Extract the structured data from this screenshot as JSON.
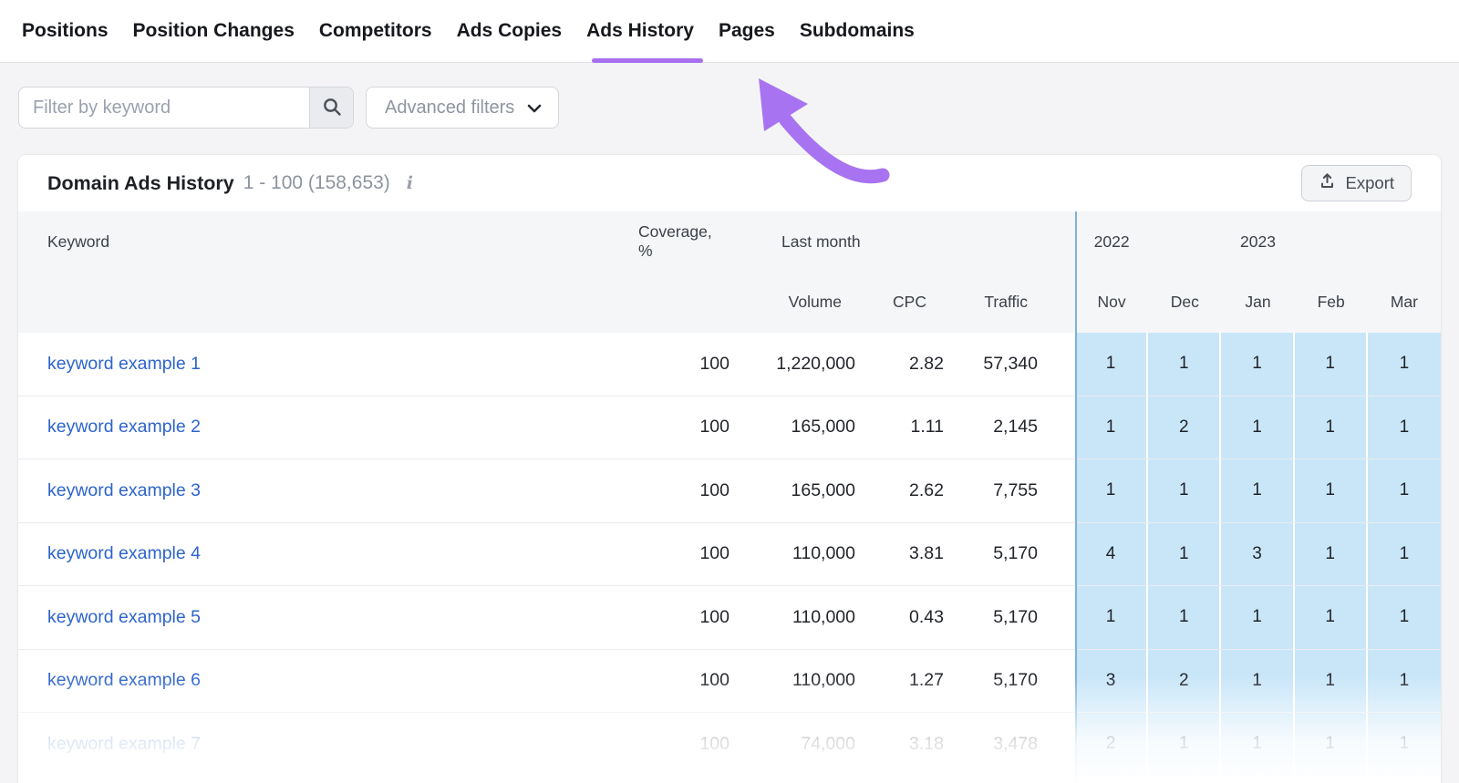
{
  "nav": {
    "tabs": [
      {
        "label": "Positions"
      },
      {
        "label": "Position Changes"
      },
      {
        "label": "Competitors"
      },
      {
        "label": "Ads Copies"
      },
      {
        "label": "Ads History",
        "active": true
      },
      {
        "label": "Pages"
      },
      {
        "label": "Subdomains"
      }
    ]
  },
  "filters": {
    "keyword_placeholder": "Filter by keyword",
    "search_icon": "magnifier-icon",
    "advanced_label": "Advanced filters",
    "advanced_icon": "chevron-down-icon"
  },
  "panel": {
    "title": "Domain Ads History",
    "range": "1 - 100 (158,653)",
    "info_icon": "info-icon",
    "export_label": "Export",
    "export_icon": "upload-icon"
  },
  "table": {
    "columns": {
      "keyword": "Keyword",
      "coverage": "Coverage, %",
      "last_month": "Last month",
      "volume": "Volume",
      "cpc": "CPC",
      "traffic": "Traffic"
    },
    "year_groups": [
      {
        "label": "2022",
        "months": [
          "Nov",
          "Dec"
        ]
      },
      {
        "label": "2023",
        "months": [
          "Jan",
          "Feb",
          "Mar"
        ]
      }
    ],
    "month_headers": [
      "Nov",
      "Dec",
      "Jan",
      "Feb",
      "Mar"
    ],
    "rows": [
      {
        "keyword": "keyword example 1",
        "coverage": "100",
        "volume": "1,220,000",
        "cpc": "2.82",
        "traffic": "57,340",
        "months": [
          "1",
          "1",
          "1",
          "1",
          "1"
        ]
      },
      {
        "keyword": "keyword example 2",
        "coverage": "100",
        "volume": "165,000",
        "cpc": "1.11",
        "traffic": "2,145",
        "months": [
          "1",
          "2",
          "1",
          "1",
          "1"
        ]
      },
      {
        "keyword": "keyword example 3",
        "coverage": "100",
        "volume": "165,000",
        "cpc": "2.62",
        "traffic": "7,755",
        "months": [
          "1",
          "1",
          "1",
          "1",
          "1"
        ]
      },
      {
        "keyword": "keyword example 4",
        "coverage": "100",
        "volume": "110,000",
        "cpc": "3.81",
        "traffic": "5,170",
        "months": [
          "4",
          "1",
          "3",
          "1",
          "1"
        ]
      },
      {
        "keyword": "keyword example 5",
        "coverage": "100",
        "volume": "110,000",
        "cpc": "0.43",
        "traffic": "5,170",
        "months": [
          "1",
          "1",
          "1",
          "1",
          "1"
        ]
      },
      {
        "keyword": "keyword example 6",
        "coverage": "100",
        "volume": "110,000",
        "cpc": "1.27",
        "traffic": "5,170",
        "months": [
          "3",
          "2",
          "1",
          "1",
          "1"
        ]
      },
      {
        "keyword": "keyword example 7",
        "coverage": "100",
        "volume": "74,000",
        "cpc": "3.18",
        "traffic": "3,478",
        "months": [
          "2",
          "1",
          "1",
          "1",
          "1"
        ]
      }
    ]
  },
  "colors": {
    "accent_purple": "#a770ee",
    "cell_blue": "#c9e6f9",
    "link_blue": "#2d64cc",
    "separator_blue": "#7cb2dc",
    "header_bg": "#f5f6f8"
  }
}
